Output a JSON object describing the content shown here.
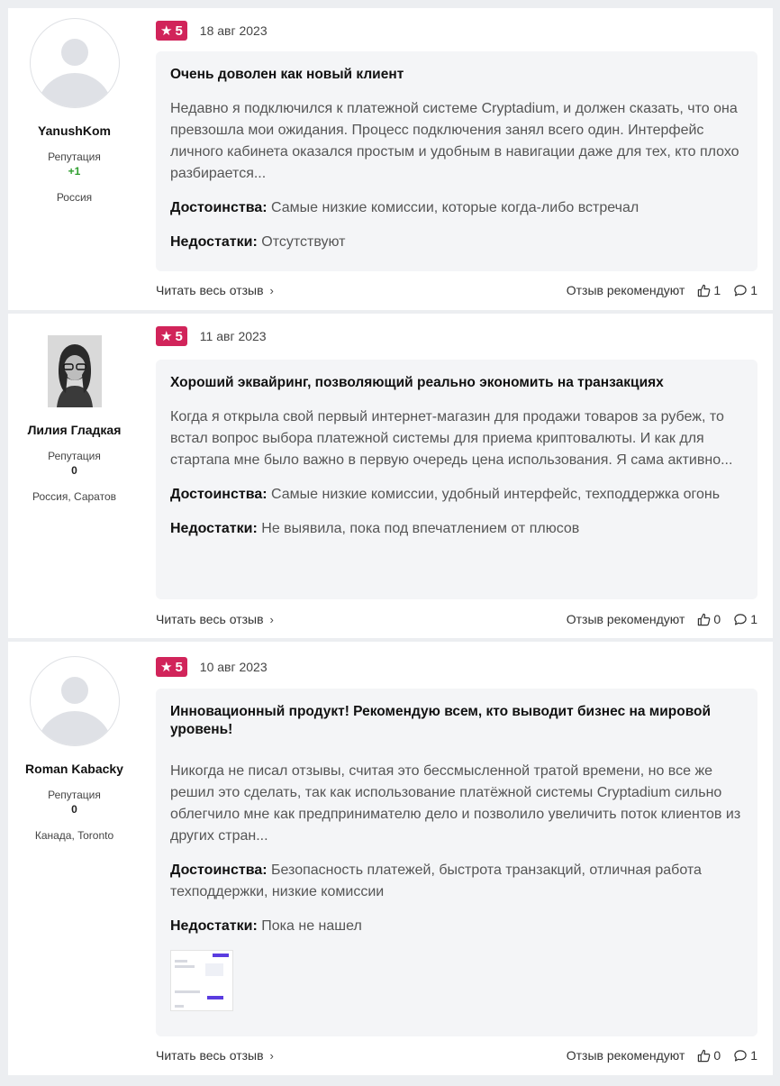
{
  "common": {
    "read_more": "Читать весь отзыв",
    "recommend_label": "Отзыв рекомендуют",
    "reputation_label": "Репутация",
    "pros_label": "Достоинства:",
    "cons_label": "Недостатки:"
  },
  "reviews": [
    {
      "author": "YanushKom",
      "reputation": "+1",
      "location": "Россия",
      "rating": "5",
      "date": "18 авг 2023",
      "title": "Очень доволен как новый клиент",
      "text": "Недавно я подключился к платежной системе Cryptadium, и должен сказать, что она превзошла мои ожидания. Процесс подключения занял всего один. Интерфейс личного кабинета оказался простым и удобным в навигации даже для тех, кто плохо разбирается...",
      "pros": "Самые низкие комиссии, которые когда-либо встречал",
      "cons": "Отсутствуют",
      "likes": "1",
      "comments": "1"
    },
    {
      "author": "Лилия Гладкая",
      "reputation": "0",
      "location": "Россия, Саратов",
      "rating": "5",
      "date": "11 авг 2023",
      "title": "Хороший эквайринг, позволяющий реально экономить на транзакциях",
      "text": "Когда я открыла свой первый интернет-магазин для продажи товаров за рубеж, то встал вопрос выбора платежной системы для приема криптовалюты. И как для стартапа мне было важно в первую очередь цена использования. Я сама активно...",
      "pros": "Самые низкие комиссии, удобный интерфейс, техподдержка огонь",
      "cons": "Не выявила, пока под впечатлением от плюсов",
      "likes": "0",
      "comments": "1"
    },
    {
      "author": "Roman Kabacky",
      "reputation": "0",
      "location": "Канада, Toronto",
      "rating": "5",
      "date": "10 авг 2023",
      "title": "Инновационный продукт! Рекомендую всем, кто выводит бизнес на мировой уровень!",
      "text": "Никогда не писал отзывы, считая это бессмысленной тратой времени, но все же решил это сделать, так как использование платёжной системы Cryptadium сильно облегчило мне как предпринимателю дело и позволило увеличить поток клиентов из других стран...",
      "pros": "Безопасность платежей, быстрота транзакций, отличная работа техподдержки, низкие комиссии",
      "cons": "Пока не нашел",
      "likes": "0",
      "comments": "1"
    }
  ],
  "colors": {
    "rating_badge": "#d1245a",
    "positive_reputation": "#2e9e2e",
    "card_background": "#f4f5f7",
    "page_background": "#eceef1"
  },
  "icons": [
    "star-icon",
    "thumbs-up-icon",
    "comment-icon",
    "chevron-right-icon",
    "default-avatar-icon"
  ]
}
